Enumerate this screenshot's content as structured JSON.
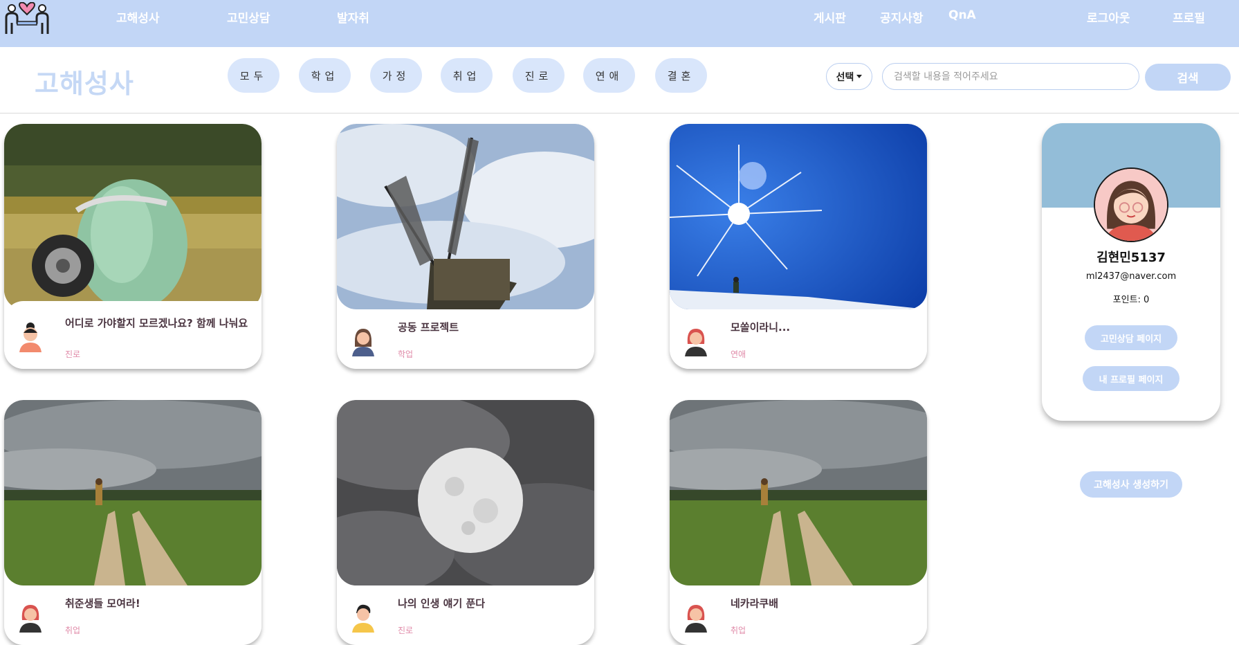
{
  "nav": {
    "left_links": [
      "고해성사",
      "고민상담",
      "발자취"
    ],
    "right_links": [
      "게시판",
      "공지사항",
      "QnA"
    ],
    "account_links": [
      "로그아웃",
      "프로필"
    ]
  },
  "filter": {
    "page_title": "고해성사",
    "categories": [
      "모두",
      "학업",
      "가정",
      "취업",
      "진로",
      "연애",
      "결혼"
    ],
    "select_label": "선택",
    "search_placeholder": "검색할 내용을 적어주세요",
    "search_button": "검색"
  },
  "posts": [
    {
      "title": "어디로 가야할지 모르겠나요? 함께 나눠요",
      "category": "진로",
      "image": "car-field"
    },
    {
      "title": "공동 프로젝트",
      "category": "학업",
      "image": "windmill"
    },
    {
      "title": "모쏠이라니...",
      "category": "연애",
      "image": "sun-snow"
    },
    {
      "title": "취준생들 모여라!",
      "category": "취업",
      "image": "path-field"
    },
    {
      "title": "나의 인생 얘기 푼다",
      "category": "진로",
      "image": "moon"
    },
    {
      "title": "네카라쿠배",
      "category": "취업",
      "image": "path-field"
    }
  ],
  "profile": {
    "name": "김현민5137",
    "email": "ml2437@naver.com",
    "points": "포인트: 0",
    "counsel_button": "고민상담 페이지",
    "profile_button": "내 프로필 페이지"
  },
  "create_button": "고해성사 생성하기",
  "colors": {
    "nav_bg": "#c2d6f6",
    "chip_bg": "#d9e6fb",
    "title_color": "#c5d8f5",
    "banner": "#93bdd8"
  }
}
